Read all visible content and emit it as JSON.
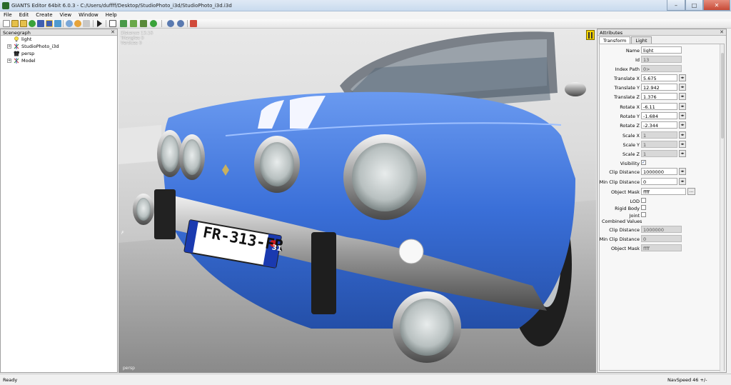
{
  "window": {
    "title": "GIANTS Editor 64bit 6.0.3 - C:/Users/duffff/Desktop/StudioPhoto_i3d/StudioPhoto_i3d.i3d",
    "minimize": "–",
    "maximize": "□",
    "close": "✕"
  },
  "menu": [
    "File",
    "Edit",
    "Create",
    "View",
    "Window",
    "Help"
  ],
  "toolbar_icons": [
    "new-file-icon",
    "open-folder-icon",
    "open-recent-icon",
    "reload-icon",
    "save-icon",
    "save-as-icon",
    "import-icon",
    "undo-icon",
    "redo-icon",
    "cut-icon",
    "play-icon",
    "select-tool-icon",
    "terrain-paint-icon",
    "foliage-paint-icon",
    "terrain-sculpt-icon",
    "vegetation-icon",
    "settings-gear-icon",
    "refresh-gear-icon",
    "export-icon"
  ],
  "scenegraph": {
    "title": "Scenegraph",
    "close": "✕",
    "nodes": [
      {
        "label": "light",
        "expander": "",
        "icon": "light-bulb-icon"
      },
      {
        "label": "StudioPhoto_i3d",
        "expander": "+",
        "icon": "transform-group-icon"
      },
      {
        "label": "persp",
        "expander": "",
        "icon": "camera-icon"
      },
      {
        "label": "Model",
        "expander": "+",
        "icon": "transform-group-icon"
      }
    ]
  },
  "viewport": {
    "stats": [
      "Distance 13.16",
      "Triangles 0",
      "Vertices 0"
    ],
    "camera_label": "persp",
    "plate_text": "FR-313-FR",
    "plate_region": "31",
    "plate_country": "F"
  },
  "attributes": {
    "title": "Attributes",
    "close": "✕",
    "tabs": [
      "Transform",
      "Light"
    ],
    "fields": {
      "name": {
        "label": "Name",
        "value": "light"
      },
      "id": {
        "label": "Id",
        "value": "13"
      },
      "index_path": {
        "label": "Index Path",
        "value": "0>"
      },
      "translate_x": {
        "label": "Translate X",
        "value": "5.675"
      },
      "translate_y": {
        "label": "Translate Y",
        "value": "12.942"
      },
      "translate_z": {
        "label": "Translate Z",
        "value": "1.376"
      },
      "rotate_x": {
        "label": "Rotate X",
        "value": "-6.11"
      },
      "rotate_y": {
        "label": "Rotate Y",
        "value": "-1.684"
      },
      "rotate_z": {
        "label": "Rotate Z",
        "value": "-2.344"
      },
      "scale_x": {
        "label": "Scale X",
        "value": "1"
      },
      "scale_y": {
        "label": "Scale Y",
        "value": "1"
      },
      "scale_z": {
        "label": "Scale Z",
        "value": "1"
      },
      "visibility": {
        "label": "Visibility",
        "checked": "✓"
      },
      "clip_distance": {
        "label": "Clip Distance",
        "value": "1000000"
      },
      "min_clip_distance": {
        "label": "Min Clip Distance",
        "value": "0"
      },
      "object_mask": {
        "label": "Object Mask",
        "value": "ffff",
        "button": "..."
      },
      "lod": {
        "label": "LOD",
        "checked": ""
      },
      "rigid_body": {
        "label": "Rigid Body",
        "checked": ""
      },
      "joint": {
        "label": "Joint",
        "checked": ""
      }
    },
    "combined": {
      "title": "Combined Values",
      "clip_distance": {
        "label": "Clip Distance",
        "value": "1000000"
      },
      "min_clip_distance": {
        "label": "Min Clip Distance",
        "value": "0"
      },
      "object_mask": {
        "label": "Object Mask",
        "value": "ffff"
      }
    },
    "stepper": "◂▸"
  },
  "status": {
    "left": "Ready",
    "right": "NavSpeed 46 +/-"
  },
  "colors": {
    "car_body": "#3a6fd8",
    "viewport_bg": "#d6d6d6",
    "accent_yellow": "#f3d300"
  }
}
